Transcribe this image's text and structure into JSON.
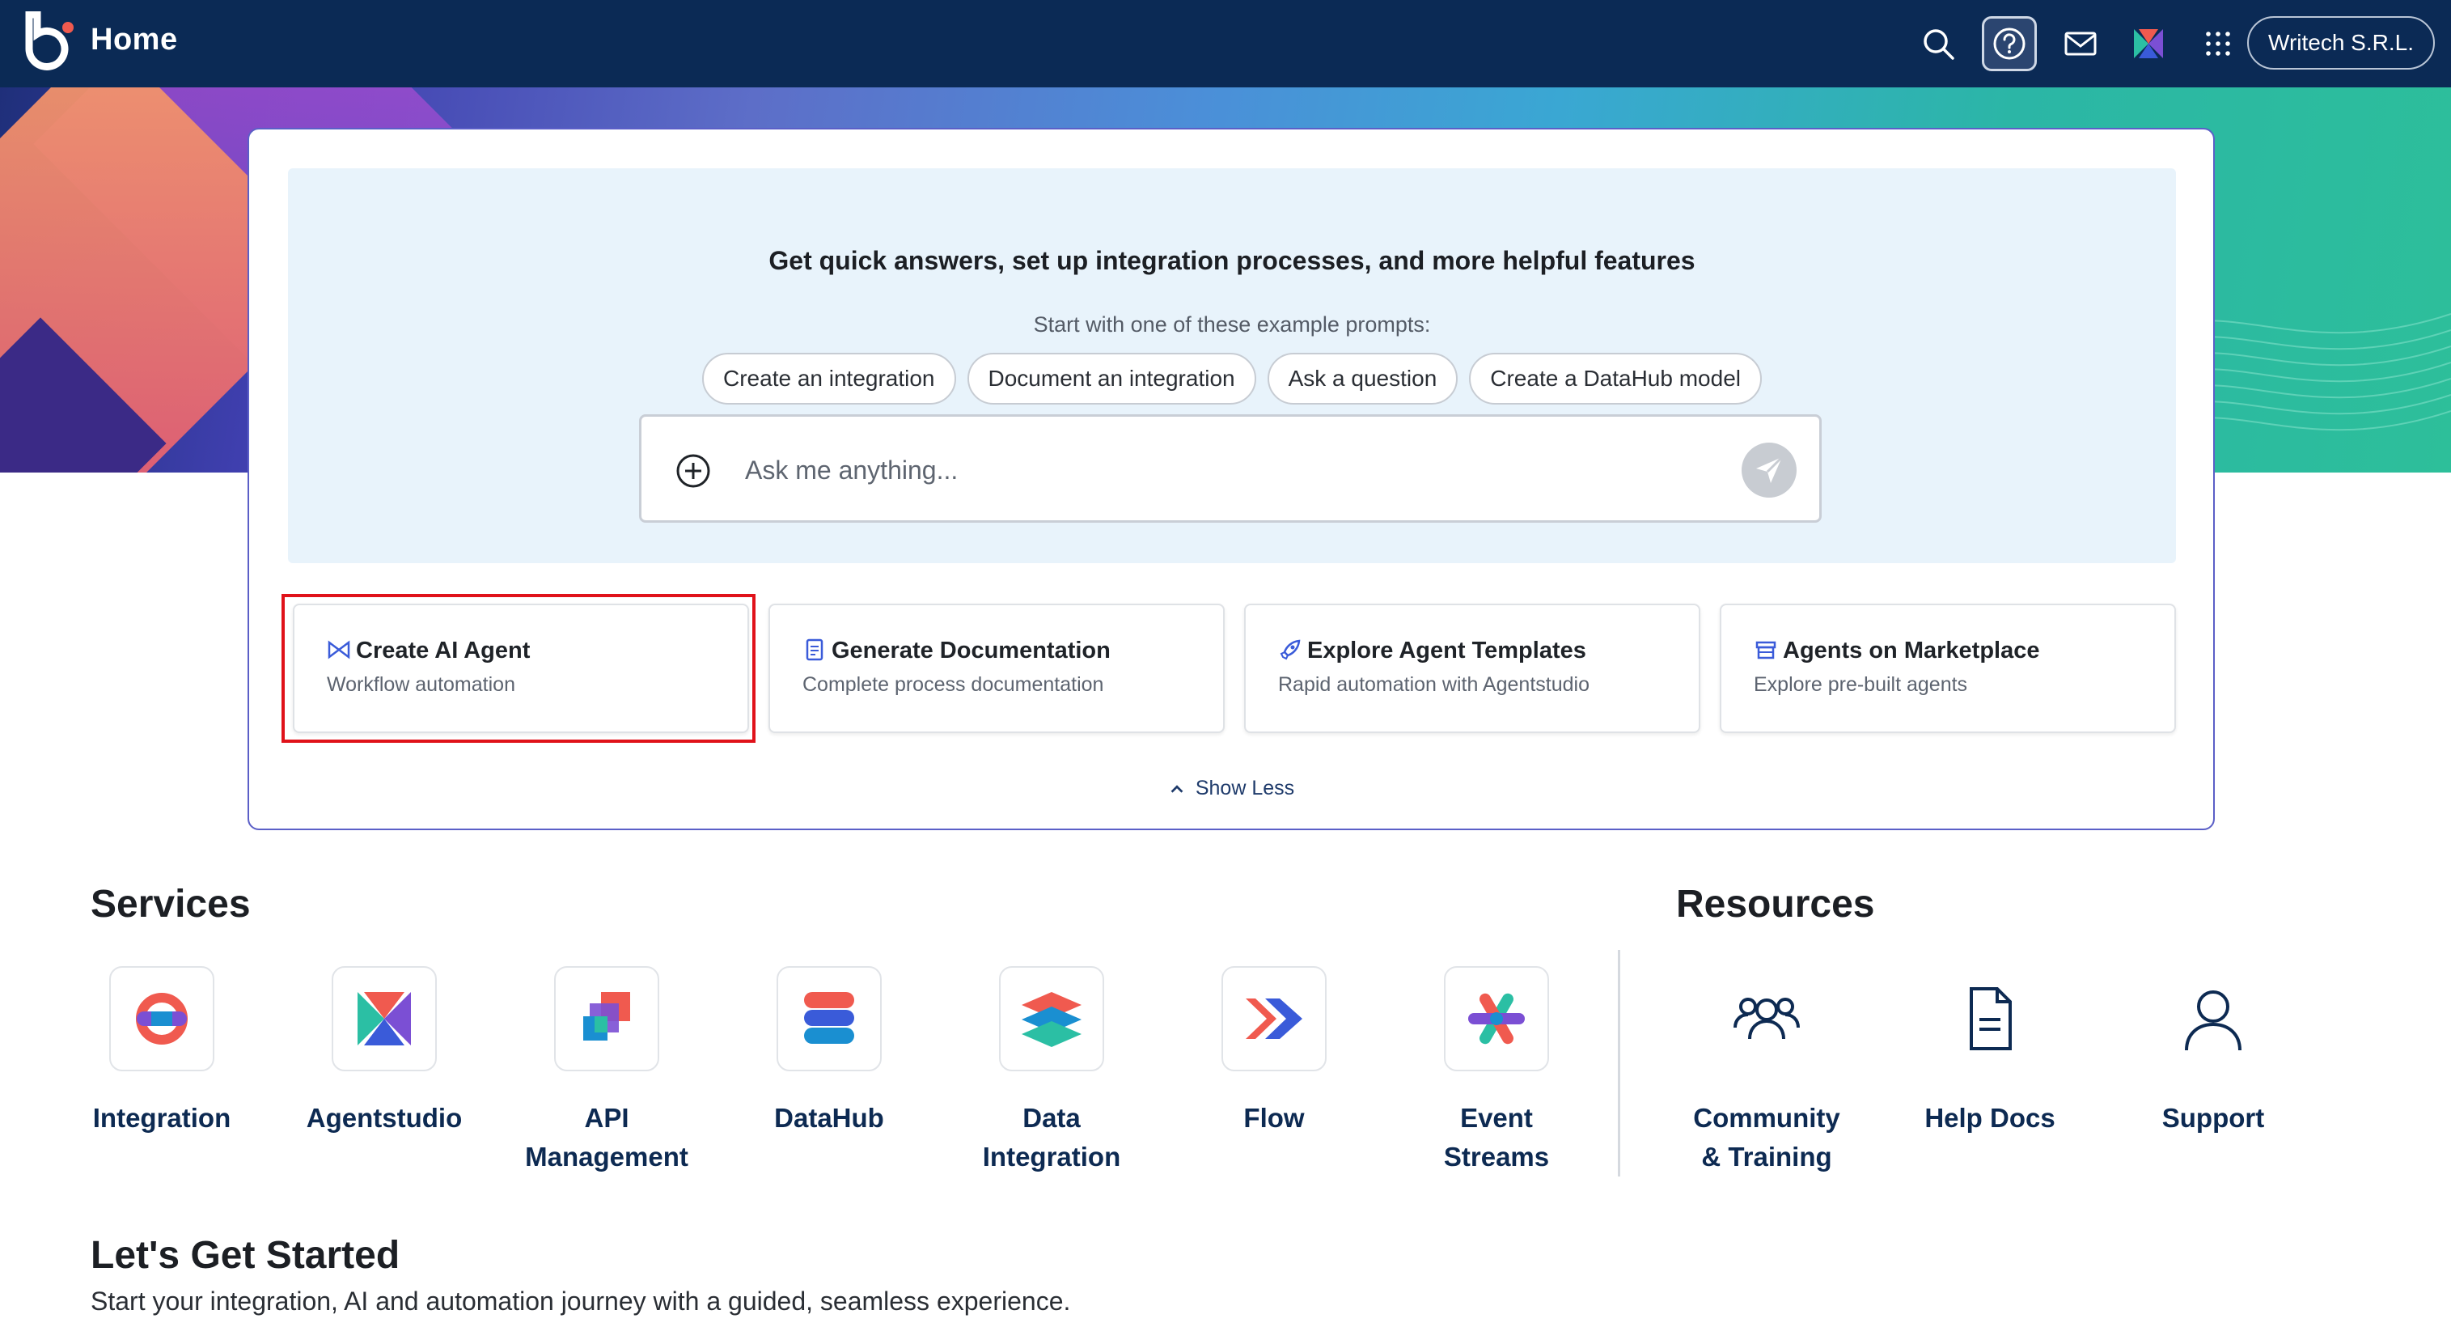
{
  "header": {
    "title": "Home",
    "account": "Writech S.R.L.",
    "icons": [
      "search-icon",
      "help-icon",
      "mail-icon",
      "agentstudio-icon",
      "apps-grid-icon"
    ]
  },
  "ai": {
    "headline": "Get quick answers, set up integration processes, and more helpful features",
    "prompts_intro": "Start with one of these example prompts:",
    "chips": [
      "Create an integration",
      "Document an integration",
      "Ask a question",
      "Create a DataHub model"
    ],
    "input_placeholder": "Ask me anything...",
    "actions": [
      {
        "title": "Create AI Agent",
        "subtitle": "Workflow automation",
        "icon": "bowtie-icon"
      },
      {
        "title": "Generate Documentation",
        "subtitle": "Complete process documentation",
        "icon": "document-icon"
      },
      {
        "title": "Explore Agent Templates",
        "subtitle": "Rapid automation with Agentstudio",
        "icon": "rocket-icon"
      },
      {
        "title": "Agents on Marketplace",
        "subtitle": "Explore pre-built agents",
        "icon": "store-icon"
      }
    ],
    "show_less": "Show Less"
  },
  "services": {
    "title": "Services",
    "items": [
      {
        "line1": "Integration",
        "line2": ""
      },
      {
        "line1": "Agentstudio",
        "line2": ""
      },
      {
        "line1": "API",
        "line2": "Management"
      },
      {
        "line1": "DataHub",
        "line2": ""
      },
      {
        "line1": "Data",
        "line2": "Integration"
      },
      {
        "line1": "Flow",
        "line2": ""
      },
      {
        "line1": "Event",
        "line2": "Streams"
      }
    ]
  },
  "resources": {
    "title": "Resources",
    "items": [
      {
        "line1": "Community",
        "line2": "& Training",
        "icon": "people-icon"
      },
      {
        "line1": "Help Docs",
        "line2": "",
        "icon": "document-icon"
      },
      {
        "line1": "Support",
        "line2": "",
        "icon": "user-icon"
      }
    ]
  },
  "get_started": {
    "title": "Let's Get Started",
    "subtitle": "Start your integration, AI and automation journey with a guided, seamless experience."
  },
  "colors": {
    "topbar": "#0b2a55",
    "accent_border": "#5b5fc7",
    "highlight": "#e0121a",
    "service_label": "#0d2a52"
  }
}
